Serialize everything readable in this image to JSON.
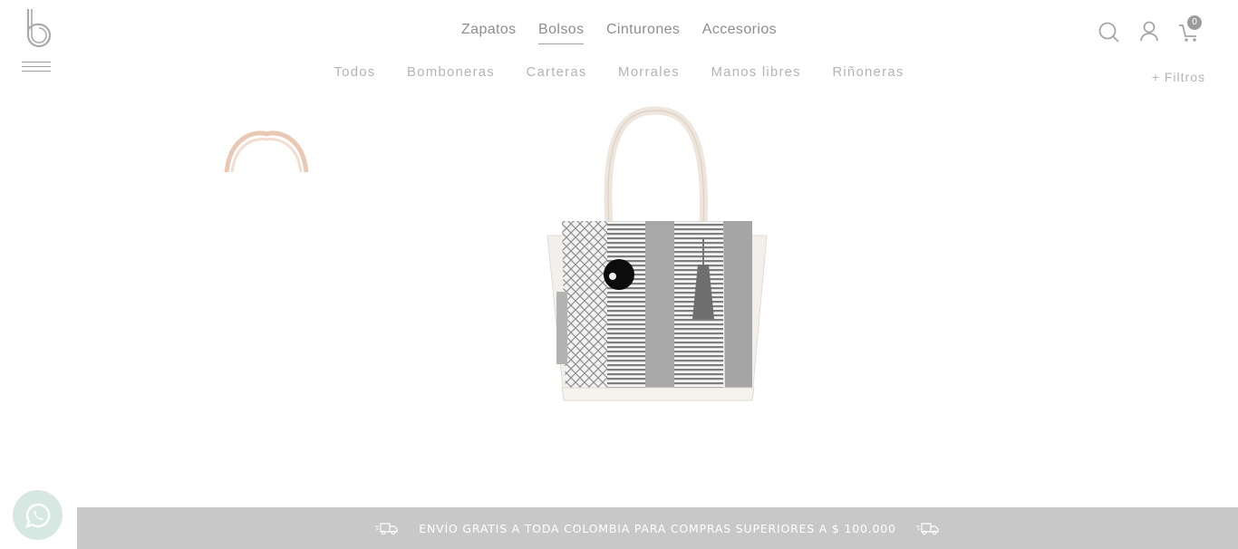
{
  "logo": {
    "icon": "brand-b-logo-icon"
  },
  "menu": {
    "icon": "hamburger-menu-icon"
  },
  "top_nav": {
    "items": [
      {
        "label": "Zapatos"
      },
      {
        "label": "Bolsos",
        "active": true
      },
      {
        "label": "Cinturones"
      },
      {
        "label": "Accesorios"
      }
    ]
  },
  "sub_nav": {
    "items": [
      {
        "label": "Todos"
      },
      {
        "label": "Bomboneras"
      },
      {
        "label": "Carteras"
      },
      {
        "label": "Morrales"
      },
      {
        "label": "Manos libres"
      },
      {
        "label": "Riñoneras"
      }
    ]
  },
  "filters": {
    "label": "+ Filtros"
  },
  "header_icons": {
    "search": "search-icon",
    "account": "user-icon",
    "cart": "cart-icon",
    "cart_count": "0"
  },
  "product": {
    "image": "woven-tote-bag-image",
    "thumbnail": "tote-bag-thumbnail"
  },
  "whatsapp": {
    "icon": "whatsapp-icon"
  },
  "shipping_banner": {
    "text": "ENVÍO GRATIS A TODA COLOMBIA PARA COMPRAS SUPERIORES A $ 100.000",
    "icon": "delivery-truck-icon"
  },
  "colors": {
    "banner_bg": "#c8c8c8",
    "text_muted": "#b4b4b4",
    "whatsapp_bg": "#d7e7e1"
  }
}
